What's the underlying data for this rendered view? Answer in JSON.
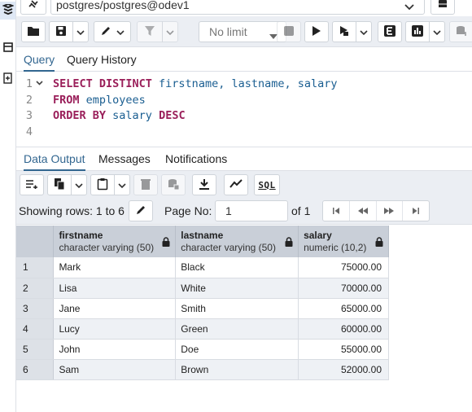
{
  "connection": {
    "name": "postgres/postgres@odev1"
  },
  "toolbar": {
    "limit_label": "No limit"
  },
  "query_tabs": [
    {
      "label": "Query"
    },
    {
      "label": "Query History"
    }
  ],
  "editor": {
    "lines": [
      {
        "num": "1",
        "kw1": "SELECT DISTINCT ",
        "rest": "firstname, lastname, salary"
      },
      {
        "num": "2",
        "kw1": "FROM ",
        "rest": "employees"
      },
      {
        "num": "3",
        "kw1": "ORDER BY ",
        "rest": "salary ",
        "kw2": "DESC"
      },
      {
        "num": "4"
      }
    ]
  },
  "result_tabs": [
    {
      "label": "Data Output"
    },
    {
      "label": "Messages"
    },
    {
      "label": "Notifications"
    }
  ],
  "data_toolbar": {
    "sql_label": "SQL",
    "rows_label": "Showing rows: 1 to 6",
    "page_label": "Page No:",
    "page_value": "1",
    "of_label": "of 1"
  },
  "grid": {
    "columns": [
      {
        "name": "firstname",
        "type": "character varying (50)"
      },
      {
        "name": "lastname",
        "type": "character varying (50)"
      },
      {
        "name": "salary",
        "type": "numeric (10,2)"
      }
    ],
    "rows": [
      {
        "n": "1",
        "firstname": "Mark",
        "lastname": "Black",
        "salary": "75000.00"
      },
      {
        "n": "2",
        "firstname": "Lisa",
        "lastname": "White",
        "salary": "70000.00"
      },
      {
        "n": "3",
        "firstname": "Jane",
        "lastname": "Smith",
        "salary": "65000.00"
      },
      {
        "n": "4",
        "firstname": "Lucy",
        "lastname": "Green",
        "salary": "60000.00"
      },
      {
        "n": "5",
        "firstname": "John",
        "lastname": "Doe",
        "salary": "55000.00"
      },
      {
        "n": "6",
        "firstname": "Sam",
        "lastname": "Brown",
        "salary": "52000.00"
      }
    ]
  },
  "colors": {
    "accent": "#326690",
    "keyword": "#9a1f5a",
    "identifier": "#1a5e91",
    "header_bg": "#c9cfd8",
    "toolbar_bg": "#ebeef3"
  },
  "icons": {
    "left_strip": [
      "database-stack-icon",
      "table-icon",
      "plus-document-icon"
    ],
    "toolbar": [
      "folder-icon",
      "save-icon",
      "pen-icon",
      "filter-icon",
      "stop-icon",
      "play-icon",
      "explain-icon",
      "e-icon",
      "chart-icon",
      "macro-icon"
    ],
    "data_toolbar": [
      "add-row-icon",
      "copy-icon",
      "paste-icon",
      "delete-icon",
      "save-data-icon",
      "download-icon",
      "graph-icon"
    ]
  }
}
